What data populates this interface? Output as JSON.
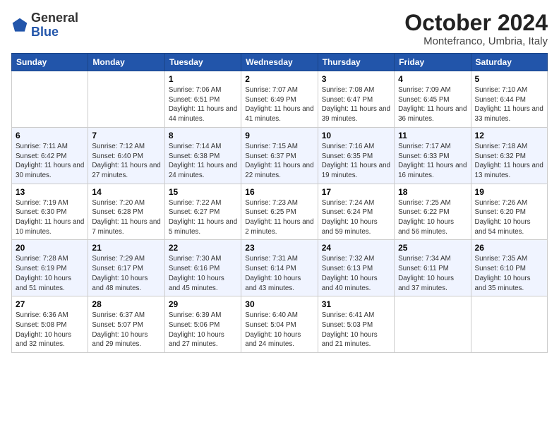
{
  "header": {
    "logo": {
      "general": "General",
      "blue": "Blue"
    },
    "title": "October 2024",
    "location": "Montefranco, Umbria, Italy"
  },
  "weekdays": [
    "Sunday",
    "Monday",
    "Tuesday",
    "Wednesday",
    "Thursday",
    "Friday",
    "Saturday"
  ],
  "weeks": [
    [
      {
        "day": "",
        "info": ""
      },
      {
        "day": "",
        "info": ""
      },
      {
        "day": "1",
        "info": "Sunrise: 7:06 AM\nSunset: 6:51 PM\nDaylight: 11 hours and 44 minutes."
      },
      {
        "day": "2",
        "info": "Sunrise: 7:07 AM\nSunset: 6:49 PM\nDaylight: 11 hours and 41 minutes."
      },
      {
        "day": "3",
        "info": "Sunrise: 7:08 AM\nSunset: 6:47 PM\nDaylight: 11 hours and 39 minutes."
      },
      {
        "day": "4",
        "info": "Sunrise: 7:09 AM\nSunset: 6:45 PM\nDaylight: 11 hours and 36 minutes."
      },
      {
        "day": "5",
        "info": "Sunrise: 7:10 AM\nSunset: 6:44 PM\nDaylight: 11 hours and 33 minutes."
      }
    ],
    [
      {
        "day": "6",
        "info": "Sunrise: 7:11 AM\nSunset: 6:42 PM\nDaylight: 11 hours and 30 minutes."
      },
      {
        "day": "7",
        "info": "Sunrise: 7:12 AM\nSunset: 6:40 PM\nDaylight: 11 hours and 27 minutes."
      },
      {
        "day": "8",
        "info": "Sunrise: 7:14 AM\nSunset: 6:38 PM\nDaylight: 11 hours and 24 minutes."
      },
      {
        "day": "9",
        "info": "Sunrise: 7:15 AM\nSunset: 6:37 PM\nDaylight: 11 hours and 22 minutes."
      },
      {
        "day": "10",
        "info": "Sunrise: 7:16 AM\nSunset: 6:35 PM\nDaylight: 11 hours and 19 minutes."
      },
      {
        "day": "11",
        "info": "Sunrise: 7:17 AM\nSunset: 6:33 PM\nDaylight: 11 hours and 16 minutes."
      },
      {
        "day": "12",
        "info": "Sunrise: 7:18 AM\nSunset: 6:32 PM\nDaylight: 11 hours and 13 minutes."
      }
    ],
    [
      {
        "day": "13",
        "info": "Sunrise: 7:19 AM\nSunset: 6:30 PM\nDaylight: 11 hours and 10 minutes."
      },
      {
        "day": "14",
        "info": "Sunrise: 7:20 AM\nSunset: 6:28 PM\nDaylight: 11 hours and 7 minutes."
      },
      {
        "day": "15",
        "info": "Sunrise: 7:22 AM\nSunset: 6:27 PM\nDaylight: 11 hours and 5 minutes."
      },
      {
        "day": "16",
        "info": "Sunrise: 7:23 AM\nSunset: 6:25 PM\nDaylight: 11 hours and 2 minutes."
      },
      {
        "day": "17",
        "info": "Sunrise: 7:24 AM\nSunset: 6:24 PM\nDaylight: 10 hours and 59 minutes."
      },
      {
        "day": "18",
        "info": "Sunrise: 7:25 AM\nSunset: 6:22 PM\nDaylight: 10 hours and 56 minutes."
      },
      {
        "day": "19",
        "info": "Sunrise: 7:26 AM\nSunset: 6:20 PM\nDaylight: 10 hours and 54 minutes."
      }
    ],
    [
      {
        "day": "20",
        "info": "Sunrise: 7:28 AM\nSunset: 6:19 PM\nDaylight: 10 hours and 51 minutes."
      },
      {
        "day": "21",
        "info": "Sunrise: 7:29 AM\nSunset: 6:17 PM\nDaylight: 10 hours and 48 minutes."
      },
      {
        "day": "22",
        "info": "Sunrise: 7:30 AM\nSunset: 6:16 PM\nDaylight: 10 hours and 45 minutes."
      },
      {
        "day": "23",
        "info": "Sunrise: 7:31 AM\nSunset: 6:14 PM\nDaylight: 10 hours and 43 minutes."
      },
      {
        "day": "24",
        "info": "Sunrise: 7:32 AM\nSunset: 6:13 PM\nDaylight: 10 hours and 40 minutes."
      },
      {
        "day": "25",
        "info": "Sunrise: 7:34 AM\nSunset: 6:11 PM\nDaylight: 10 hours and 37 minutes."
      },
      {
        "day": "26",
        "info": "Sunrise: 7:35 AM\nSunset: 6:10 PM\nDaylight: 10 hours and 35 minutes."
      }
    ],
    [
      {
        "day": "27",
        "info": "Sunrise: 6:36 AM\nSunset: 5:08 PM\nDaylight: 10 hours and 32 minutes."
      },
      {
        "day": "28",
        "info": "Sunrise: 6:37 AM\nSunset: 5:07 PM\nDaylight: 10 hours and 29 minutes."
      },
      {
        "day": "29",
        "info": "Sunrise: 6:39 AM\nSunset: 5:06 PM\nDaylight: 10 hours and 27 minutes."
      },
      {
        "day": "30",
        "info": "Sunrise: 6:40 AM\nSunset: 5:04 PM\nDaylight: 10 hours and 24 minutes."
      },
      {
        "day": "31",
        "info": "Sunrise: 6:41 AM\nSunset: 5:03 PM\nDaylight: 10 hours and 21 minutes."
      },
      {
        "day": "",
        "info": ""
      },
      {
        "day": "",
        "info": ""
      }
    ]
  ]
}
